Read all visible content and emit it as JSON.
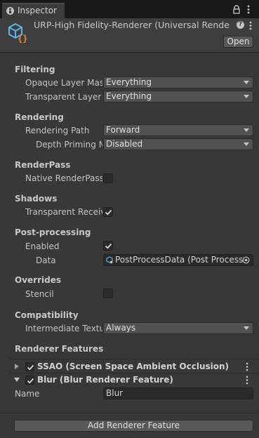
{
  "tab": {
    "title": "Inspector"
  },
  "header": {
    "title": "URP-High Fidelity-Renderer (Universal Rende",
    "open_button": "Open"
  },
  "sections": {
    "filtering": {
      "title": "Filtering",
      "opaque_label": "Opaque Layer Mask",
      "opaque_value": "Everything",
      "transparent_label": "Transparent Layer Mask",
      "transparent_value": "Everything"
    },
    "rendering": {
      "title": "Rendering",
      "path_label": "Rendering Path",
      "path_value": "Forward",
      "depth_label": "Depth Priming Mode",
      "depth_value": "Disabled"
    },
    "renderpass": {
      "title": "RenderPass",
      "native_label": "Native RenderPass"
    },
    "shadows": {
      "title": "Shadows",
      "transparent_label": "Transparent Receive Shadows"
    },
    "postprocessing": {
      "title": "Post-processing",
      "enabled_label": "Enabled",
      "data_label": "Data",
      "data_value": "PostProcessData (Post Process"
    },
    "overrides": {
      "title": "Overrides",
      "stencil_label": "Stencil"
    },
    "compatibility": {
      "title": "Compatibility",
      "intermediate_label": "Intermediate Texture",
      "intermediate_value": "Always"
    },
    "features": {
      "title": "Renderer Features",
      "items": [
        {
          "label": "SSAO (Screen Space Ambient Occlusion)",
          "enabled": true,
          "expanded": false
        },
        {
          "label": "Blur (Blur Renderer Feature)",
          "enabled": true,
          "expanded": true
        }
      ],
      "blur_name_label": "Name",
      "blur_name_value": "Blur",
      "add_button": "Add Renderer Feature"
    }
  },
  "checkbox_states": {
    "native_renderpass": false,
    "transparent_receive": true,
    "postprocessing_enabled": true,
    "stencil": false
  },
  "icons": [
    "info-icon",
    "lock-icon",
    "menu-icon",
    "asset-icon",
    "help-icon",
    "settings-icon",
    "kebab-icon",
    "object-picker-icon",
    "foldout-arrow-icon",
    "check-icon"
  ],
  "colors": {
    "background": "#383838",
    "tab_bar": "#191919",
    "header": "#3e3e3e",
    "dropdown": "#515151"
  }
}
